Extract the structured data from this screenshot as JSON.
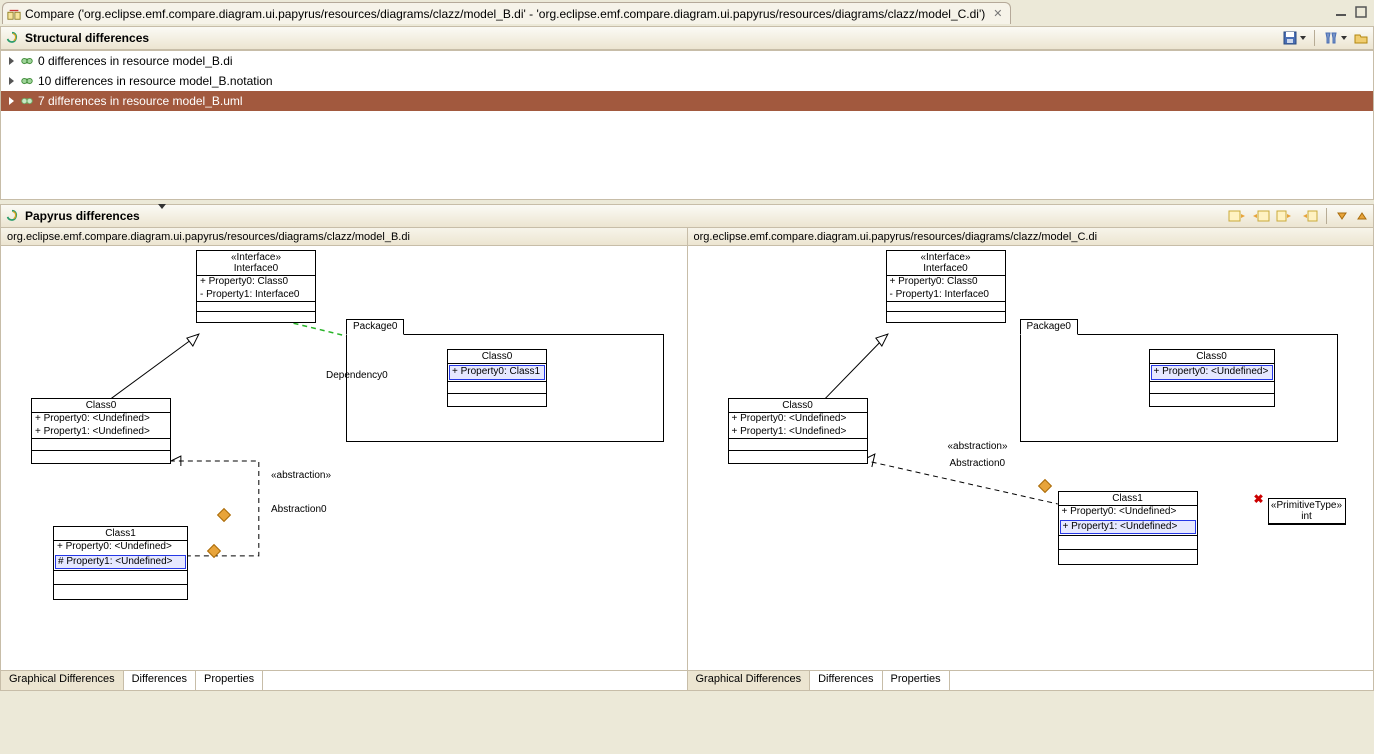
{
  "compareTab": {
    "prefix": "Compare (",
    "left": "'org.eclipse.emf.compare.diagram.ui.papyrus/resources/diagrams/clazz/model_B.di'",
    "mid": " - ",
    "right": "'org.eclipse.emf.compare.diagram.ui.papyrus/resources/diagrams/clazz/model_C.di'",
    "suffix": ")"
  },
  "structural": {
    "title": "Structural differences",
    "rows": [
      {
        "label": "0 differences in resource model_B.di",
        "selected": false
      },
      {
        "label": "10 differences in resource model_B.notation",
        "selected": false
      },
      {
        "label": "7 differences in resource model_B.uml",
        "selected": true
      }
    ]
  },
  "papyrus": {
    "title": "Papyrus differences",
    "panes": {
      "left": {
        "path": "org.eclipse.emf.compare.diagram.ui.papyrus/resources/diagrams/clazz/model_B.di",
        "tabs": [
          "Graphical Differences",
          "Differences",
          "Properties"
        ],
        "activeTab": 0,
        "diagram": {
          "interface0": {
            "stereo": "«Interface»",
            "name": "Interface0",
            "props": [
              "+ Property0: Class0",
              "- Property1: Interface0"
            ]
          },
          "class0": {
            "name": "Class0",
            "props": [
              "+ Property0: <Undefined>",
              "+ Property1: <Undefined>"
            ]
          },
          "class1": {
            "name": "Class1",
            "props": [
              "+ Property0: <Undefined>",
              "# Property1: <Undefined>"
            ],
            "hlIndex": 1
          },
          "package0": {
            "label": "Package0",
            "innerClass": {
              "name": "Class0",
              "props": [
                "+ Property0: Class1"
              ],
              "hlIndex": 0
            }
          },
          "dep": "Dependency0",
          "absStereo": "«abstraction»",
          "absName": "Abstraction0"
        }
      },
      "right": {
        "path": "org.eclipse.emf.compare.diagram.ui.papyrus/resources/diagrams/clazz/model_C.di",
        "tabs": [
          "Graphical Differences",
          "Differences",
          "Properties"
        ],
        "activeTab": 0,
        "diagram": {
          "interface0": {
            "stereo": "«Interface»",
            "name": "Interface0",
            "props": [
              "+ Property0: Class0",
              "- Property1: Interface0"
            ]
          },
          "class0": {
            "name": "Class0",
            "props": [
              "+ Property0: <Undefined>",
              "+ Property1: <Undefined>"
            ]
          },
          "class1": {
            "name": "Class1",
            "props": [
              "+ Property0: <Undefined>",
              "+ Property1: <Undefined>"
            ],
            "hlIndex": 1
          },
          "package0": {
            "label": "Package0",
            "innerClass": {
              "name": "Class0",
              "props": [
                "+ Property0: <Undefined>"
              ],
              "hlIndex": 0
            }
          },
          "absStereo": "«abstraction»",
          "absName": "Abstraction0",
          "primType": {
            "stereo": "«PrimitiveType»",
            "name": "int"
          }
        }
      }
    }
  }
}
